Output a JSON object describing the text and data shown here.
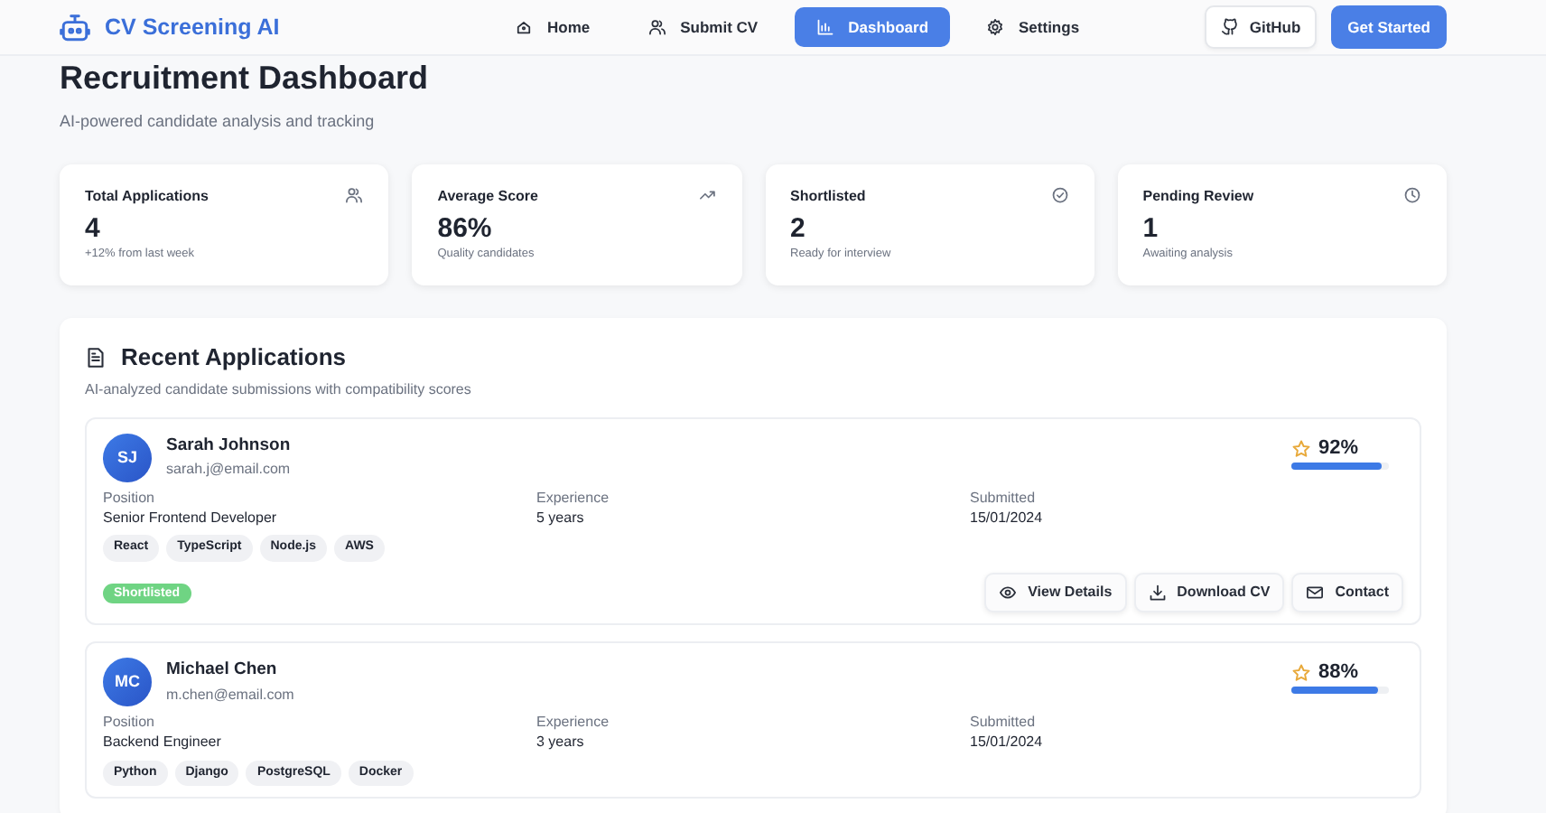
{
  "brand": {
    "name": "CV Screening AI"
  },
  "nav": [
    {
      "label": "Home",
      "selected": false
    },
    {
      "label": "Submit CV",
      "selected": false
    },
    {
      "label": "Dashboard",
      "selected": true
    },
    {
      "label": "Settings",
      "selected": false
    }
  ],
  "nav_actions": [
    {
      "label": "GitHub",
      "kind": "outline"
    },
    {
      "label": "Get Started",
      "kind": "primary"
    }
  ],
  "page": {
    "title": "Recruitment Dashboard",
    "subtitle": "AI-powered candidate analysis and tracking"
  },
  "stats": [
    {
      "title": "Total Applications",
      "value": "4",
      "note": "+12% from last week"
    },
    {
      "title": "Average Score",
      "value": "86%",
      "note": "Quality candidates"
    },
    {
      "title": "Shortlisted",
      "value": "2",
      "note": "Ready for interview"
    },
    {
      "title": "Pending Review",
      "value": "1",
      "note": "Awaiting analysis"
    }
  ],
  "recent": {
    "title": "Recent Applications",
    "subtitle": "AI-analyzed candidate submissions with compatibility scores",
    "applications": [
      {
        "initials": "SJ",
        "name": "Sarah Johnson",
        "email": "sarah.j@email.com",
        "score": "92%",
        "level": 0.92,
        "fields": [
          {
            "label": "Position",
            "value": "Senior Frontend Developer"
          },
          {
            "label": "Experience",
            "value": "5 years"
          },
          {
            "label": "Submitted",
            "value": "15/01/2024"
          }
        ],
        "skills": [
          "React",
          "TypeScript",
          "Node.js",
          "AWS"
        ],
        "status": "Shortlisted",
        "actions": [
          "View Details",
          "Download CV",
          "Contact"
        ]
      },
      {
        "initials": "MC",
        "name": "Michael Chen",
        "email": "m.chen@email.com",
        "score": "88%",
        "level": 0.88,
        "fields": [
          {
            "label": "Position",
            "value": "Backend Engineer"
          },
          {
            "label": "Experience",
            "value": "3 years"
          },
          {
            "label": "Submitted",
            "value": "15/01/2024"
          }
        ],
        "skills": [
          "Python",
          "Django",
          "PostgreSQL",
          "Docker"
        ]
      }
    ]
  }
}
